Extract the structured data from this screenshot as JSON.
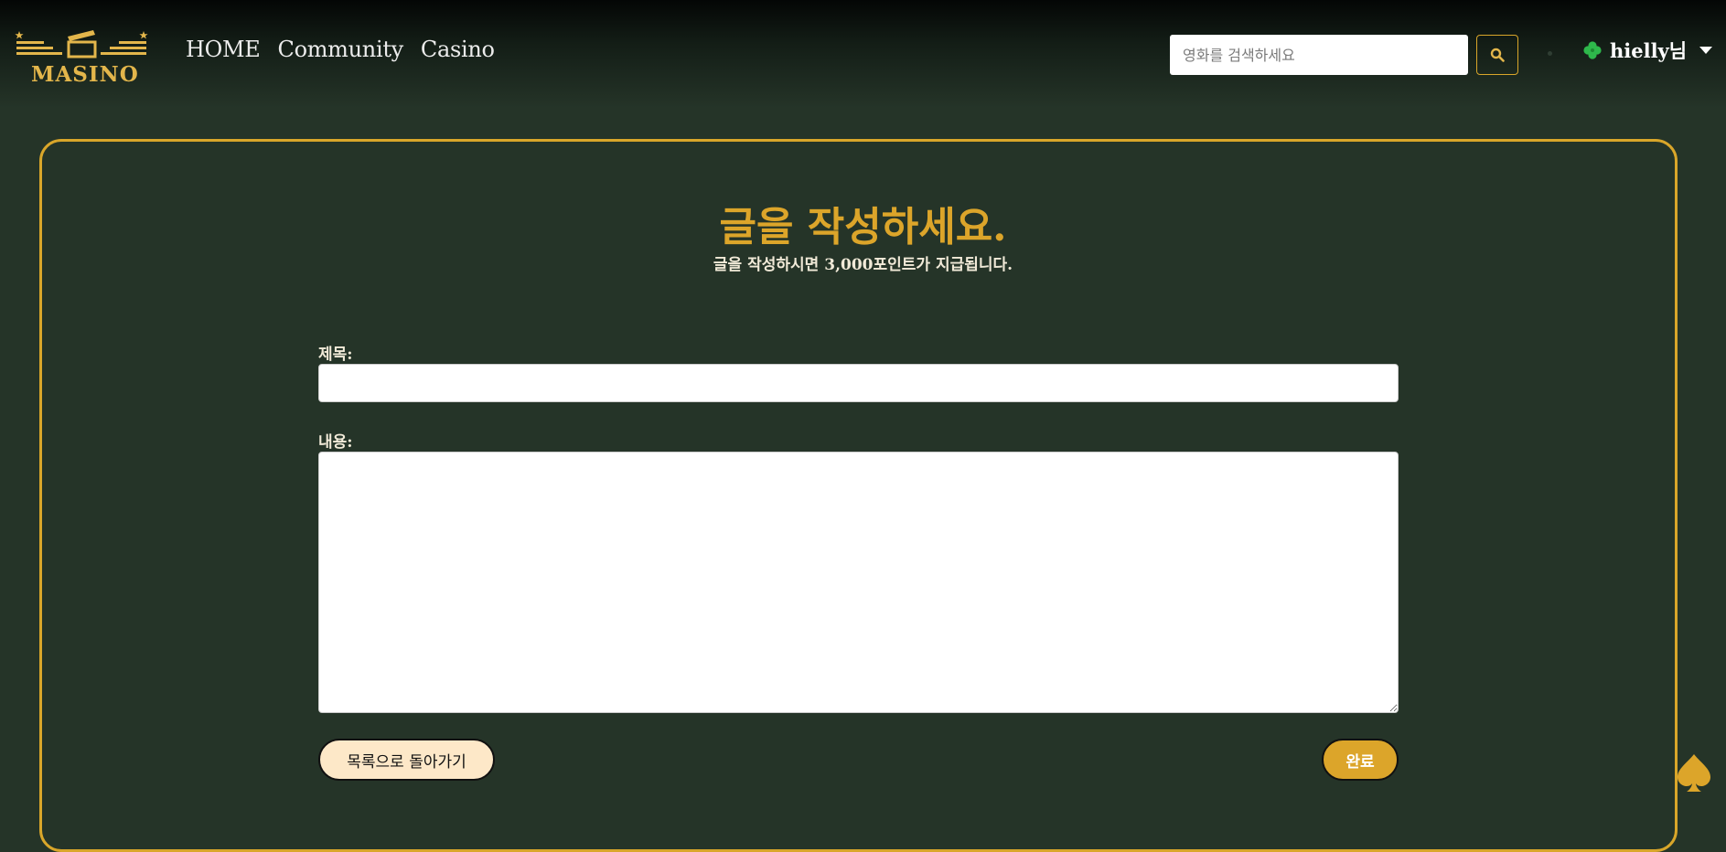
{
  "header": {
    "logo_text": "MASINO",
    "nav": [
      "HOME",
      "Community",
      "Casino"
    ],
    "search": {
      "placeholder": "영화를 검색하세요",
      "value": ""
    },
    "search_icon": "search-icon",
    "user": {
      "icon": "clover-icon",
      "name": "hielly님",
      "caret_icon": "caret-down-icon"
    }
  },
  "form": {
    "title": "글을 작성하세요.",
    "subtitle": "글을 작성하시면 3,000포인트가 지급됩니다.",
    "title_label": "제목:",
    "title_value": "",
    "content_label": "내용:",
    "content_value": "",
    "back_label": "목록으로 돌아가기",
    "submit_label": "완료"
  },
  "floating_icon": "spade-icon",
  "colors": {
    "background": "#253428",
    "accent": "#dca52a",
    "back_button": "#fde8c8"
  }
}
